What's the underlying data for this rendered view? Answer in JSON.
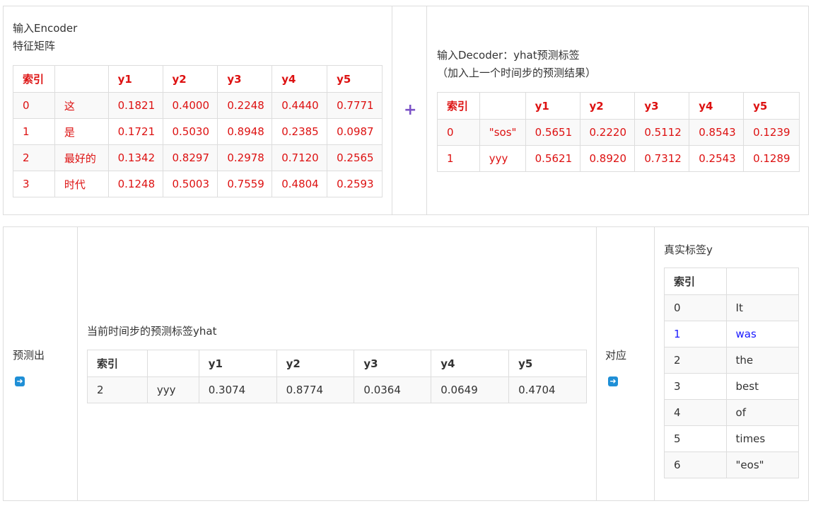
{
  "encoder": {
    "title_line1": "输入Encoder",
    "title_line2": "特征矩阵",
    "headers": [
      "索引",
      "",
      "y1",
      "y2",
      "y3",
      "y4",
      "y5"
    ],
    "rows": [
      [
        "0",
        "这",
        "0.1821",
        "0.4000",
        "0.2248",
        "0.4440",
        "0.7771"
      ],
      [
        "1",
        "是",
        "0.1721",
        "0.5030",
        "0.8948",
        "0.2385",
        "0.0987"
      ],
      [
        "2",
        "最好的",
        "0.1342",
        "0.8297",
        "0.2978",
        "0.7120",
        "0.2565"
      ],
      [
        "3",
        "时代",
        "0.1248",
        "0.5003",
        "0.7559",
        "0.4804",
        "0.2593"
      ]
    ],
    "text_color": "#dd1111"
  },
  "operator": {
    "symbol": "+",
    "color": "#7b52c7"
  },
  "decoder": {
    "title_line1": "输入Decoder：yhat预测标签",
    "title_line2": "（加入上一个时间步的预测结果）",
    "headers": [
      "索引",
      "",
      "y1",
      "y2",
      "y3",
      "y4",
      "y5"
    ],
    "rows": [
      [
        "0",
        "\"sos\"",
        "0.5651",
        "0.2220",
        "0.5112",
        "0.8543",
        "0.1239"
      ],
      [
        "1",
        "yyy",
        "0.5621",
        "0.8920",
        "0.7312",
        "0.2543",
        "0.1289"
      ]
    ]
  },
  "predict": {
    "label": "预测出",
    "arrow_icon": "right-arrow-icon",
    "title": "当前时间步的预测标签yhat",
    "headers": [
      "索引",
      "",
      "y1",
      "y2",
      "y3",
      "y4",
      "y5"
    ],
    "rows": [
      [
        "2",
        "yyy",
        "0.3074",
        "0.8774",
        "0.0364",
        "0.0649",
        "0.4704"
      ]
    ]
  },
  "correspond": {
    "label": "对应",
    "arrow_icon": "right-arrow-icon"
  },
  "truth": {
    "title": "真实标签y",
    "headers": [
      "索引",
      ""
    ],
    "rows": [
      [
        "0",
        "It"
      ],
      [
        "1",
        "was"
      ],
      [
        "2",
        "the"
      ],
      [
        "3",
        "best"
      ],
      [
        "4",
        "of"
      ],
      [
        "5",
        "times"
      ],
      [
        "6",
        "\"eos\""
      ]
    ],
    "highlight_row": 1,
    "highlight_color": "#1a1aff"
  }
}
